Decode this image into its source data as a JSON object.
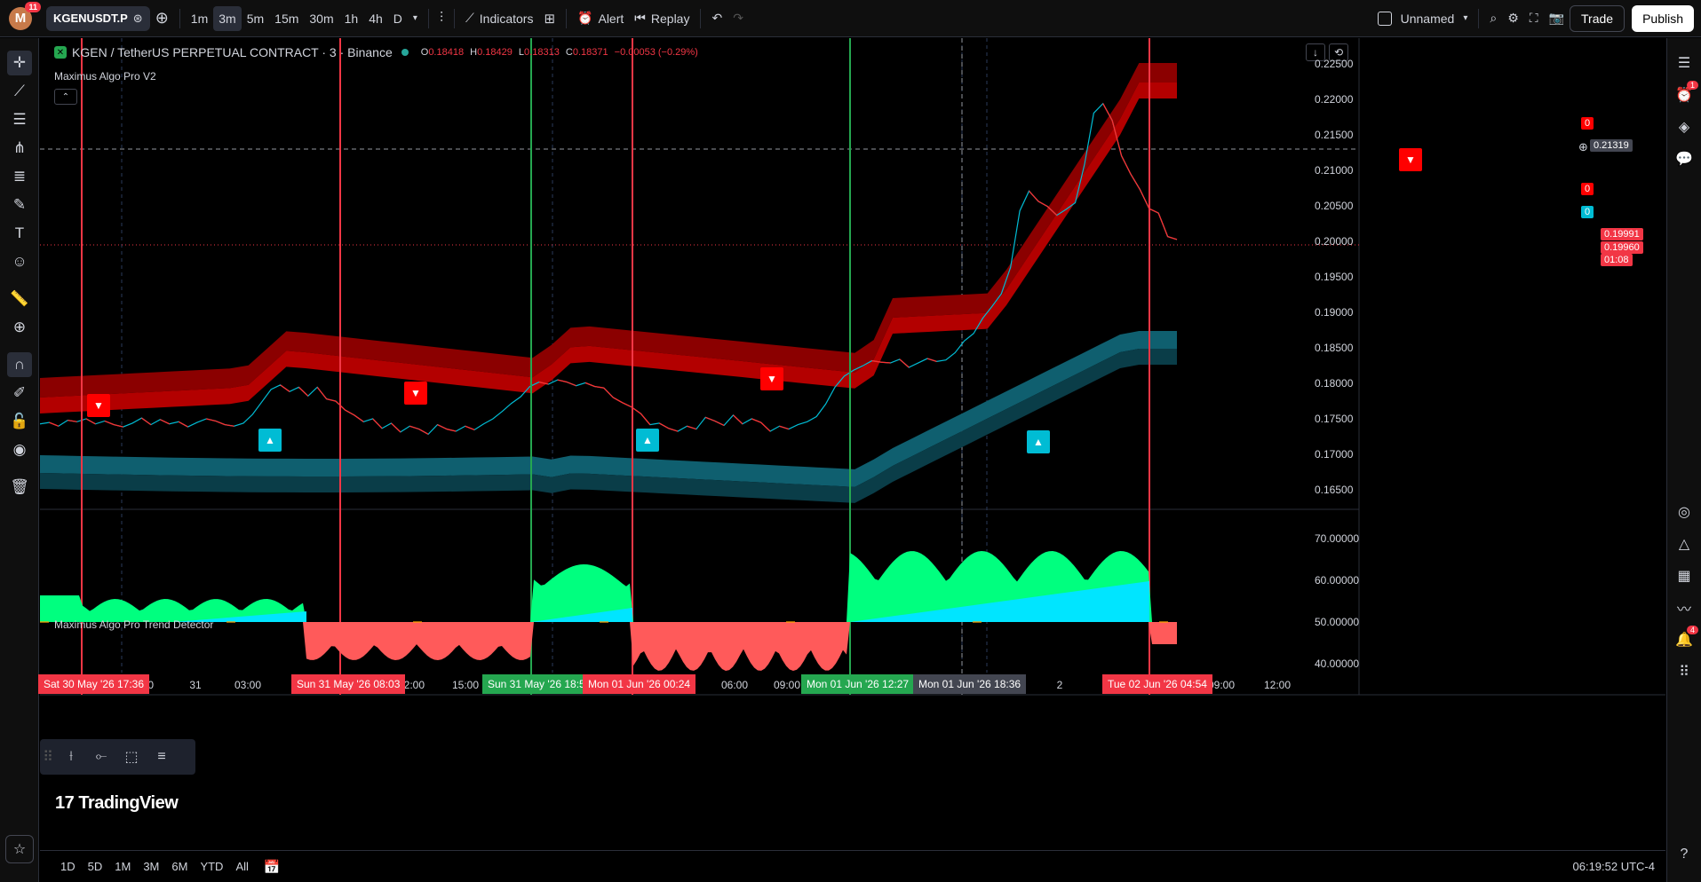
{
  "topbar": {
    "avatar_letter": "M",
    "notification_count": "11",
    "symbol": "KGENUSDT.P",
    "timeframes": [
      "1m",
      "3m",
      "5m",
      "15m",
      "30m",
      "1h",
      "4h",
      "D"
    ],
    "active_timeframe": "3m",
    "indicators_label": "Indicators",
    "alert_label": "Alert",
    "replay_label": "Replay",
    "layout_name": "Unnamed",
    "trade_label": "Trade",
    "publish_label": "Publish"
  },
  "legend": {
    "title": "KGEN / TetherUS PERPETUAL CONTRACT · 3 · Binance",
    "o_label": "O",
    "o_value": "0.18418",
    "h_label": "H",
    "h_value": "0.18429",
    "l_label": "L",
    "l_value": "0.18313",
    "c_label": "C",
    "c_value": "0.18371",
    "change": "−0.00053 (−0.29%)"
  },
  "indicator_main": "Maximus Algo Pro V2",
  "indicator_sub": "Maximus Algo Pro Trend Detector",
  "price_axis": {
    "ticks": [
      "0.22500",
      "0.22000",
      "0.21500",
      "0.21000",
      "0.20500",
      "0.20000",
      "0.19500",
      "0.19000",
      "0.18500",
      "0.18000",
      "0.17500",
      "0.17000",
      "0.16500"
    ],
    "crosshair_price": "0.21319",
    "label_zero_1": "0",
    "label_zero_2": "0",
    "label_zero_3": "0",
    "last_price_1": "0.19991",
    "last_price_2": "0.19960",
    "countdown": "01:08"
  },
  "osc_axis": {
    "ticks": [
      "70.00000",
      "60.00000",
      "50.00000",
      "40.00000"
    ]
  },
  "time_axis": {
    "ticks": [
      {
        "label": "21:00"
      },
      {
        "label": "31"
      },
      {
        "label": "03:00"
      },
      {
        "label": "12:00"
      },
      {
        "label": "15:00"
      },
      {
        "label": "06:00"
      },
      {
        "label": "09:00"
      },
      {
        "label": "2"
      },
      {
        "label": "09:00"
      },
      {
        "label": "12:00"
      },
      {
        "label": "0"
      },
      {
        "label": "0"
      }
    ],
    "boxes": [
      {
        "label": "Sat 30 May '26   17:36",
        "color": "red"
      },
      {
        "label": "Sun 31 May '26   08:03",
        "color": "red"
      },
      {
        "label": "Sun 31 May '26   18:51",
        "color": "green"
      },
      {
        "label": "Mon 01 Jun '26   00:24",
        "color": "red"
      },
      {
        "label": "Mon 01 Jun '26   12:27",
        "color": "green"
      },
      {
        "label": "Mon 01 Jun '26   18:36",
        "color": "gray"
      },
      {
        "label": "Tue 02 Jun '26   04:54",
        "color": "red"
      }
    ]
  },
  "bottombar": {
    "ranges": [
      "1D",
      "5D",
      "1M",
      "3M",
      "6M",
      "YTD",
      "All"
    ],
    "clock": "06:19:52 UTC-4"
  },
  "branding": "TradingView",
  "colors": {
    "bull": "#00bcd4",
    "bear": "#ff0000",
    "osc_bull": "#00ff7f",
    "osc_bear": "#ff5a5a",
    "buy_line": "#25a750",
    "sell_line": "#f23645"
  },
  "right_badges": {
    "alerts": "1",
    "notifications": "4"
  },
  "chart_data": {
    "type": "line",
    "title": "KGEN / TetherUS PERPETUAL CONTRACT · 3 · Binance",
    "ylim": [
      0.163,
      0.227
    ],
    "price_series": [
      0.1745,
      0.1747,
      0.1742,
      0.175,
      0.1748,
      0.1752,
      0.1745,
      0.1749,
      0.1744,
      0.1741,
      0.1746,
      0.1753,
      0.1744,
      0.1751,
      0.1745,
      0.1748,
      0.1741,
      0.1747,
      0.1752,
      0.1749,
      0.1744,
      0.1742,
      0.1746,
      0.1758,
      0.1775,
      0.1792,
      0.1798,
      0.1789,
      0.1795,
      0.1783,
      0.1795,
      0.1779,
      0.1776,
      0.1764,
      0.1757,
      0.1748,
      0.1752,
      0.1739,
      0.1746,
      0.1734,
      0.1742,
      0.1738,
      0.1731,
      0.1744,
      0.1738,
      0.1735,
      0.1742,
      0.1737,
      0.1745,
      0.1752,
      0.1762,
      0.1773,
      0.1782,
      0.1796,
      0.1802,
      0.1799,
      0.1805,
      0.1802,
      0.1797,
      0.1801,
      0.1796,
      0.1794,
      0.1781,
      0.1774,
      0.1768,
      0.1759,
      0.1744,
      0.1746,
      0.1739,
      0.1735,
      0.1742,
      0.1738,
      0.1754,
      0.1749,
      0.1743,
      0.1757,
      0.1745,
      0.1752,
      0.1747,
      0.1735,
      0.1742,
      0.1738,
      0.1744,
      0.1748,
      0.1755,
      0.1772,
      0.1795,
      0.181,
      0.1818,
      0.1824,
      0.1831,
      0.1829,
      0.1828,
      0.1833,
      0.1822,
      0.1828,
      0.1834,
      0.183,
      0.1832,
      0.1842,
      0.1858,
      0.1868,
      0.1889,
      0.1905,
      0.1922,
      0.1958,
      0.2035,
      0.2062,
      0.2048,
      0.2041,
      0.2029,
      0.2037,
      0.2046,
      0.2098,
      0.2168,
      0.2181,
      0.2158,
      0.211,
      0.2085,
      0.2064,
      0.2038,
      0.2032,
      0.2,
      0.1996
    ]
  }
}
